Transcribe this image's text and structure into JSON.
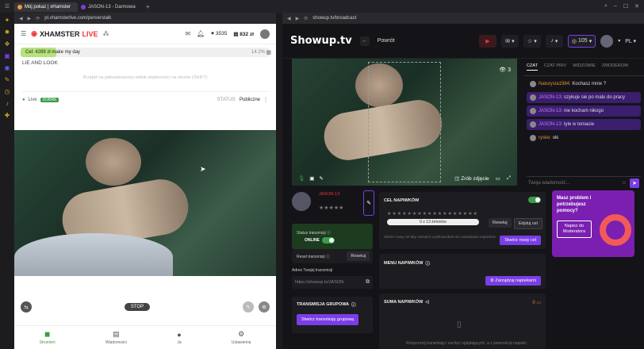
{
  "browser": {
    "tabs": [
      {
        "label": "Mój pokaz | xHamster"
      },
      {
        "label": "JASON-13 - Darmowa"
      }
    ],
    "left_url": "pl.xhamsterlive.com/perverstalk",
    "right_url": "showup.tv/broadcast"
  },
  "xh": {
    "logo_a": "XHAMSTER",
    "logo_b": "LIVE",
    "hearts": "3535",
    "tokens": "832 zł",
    "goal_text": "Cel: 4289 zł make my day",
    "goal_pct": "14.2%",
    "goal_fraction": 0.142,
    "subject": "LIE AND LOOK",
    "notice": "Przejdź na pełnoekranowy widok wiadomości na stronie (SHIFT)",
    "live_label": "Live",
    "quality": "DOBRE",
    "status_label": "STATUS:",
    "status_value": "Publiczne",
    "stop_label": "STOP",
    "nav": [
      {
        "label": "Strumień",
        "icon": "camera-icon"
      },
      {
        "label": "Wiadomości",
        "icon": "messages-icon"
      },
      {
        "label": "Ja",
        "icon": "user-icon"
      },
      {
        "label": "Ustawienia",
        "icon": "settings-icon"
      }
    ]
  },
  "sh": {
    "logo": "Showup.tv",
    "back_label": "Powrót",
    "tokens": "105",
    "lang": "PL",
    "viewers": "3",
    "snapshot_label": "Zrób zdjęcie",
    "chat_tabs": [
      "CZAT",
      "CZAT PRIV",
      "WIDZOWIE",
      "ZMODEROW"
    ],
    "messages": [
      {
        "user": "Naturysta1984:",
        "text": "Kochasz mnie ?",
        "hl": false,
        "orange": true
      },
      {
        "user": "JASON-13:",
        "text": "szykuje sie po malu do pracy",
        "hl": true,
        "orange": false
      },
      {
        "user": "JASON-13:",
        "text": "nie kocham nikogo",
        "hl": true,
        "orange": false
      },
      {
        "user": "JASON-13:",
        "text": "tyle w temacie",
        "hl": true,
        "orange": false
      },
      {
        "user": "ryske:",
        "text": "oki",
        "hl": false,
        "orange": true
      }
    ],
    "chat_placeholder": "Twoja wiadomość...",
    "username": "JASON-13",
    "stream_status_label": "Status transmisji",
    "online_label": "ONLINE",
    "reset_label": "Reset transmisji",
    "reset_btn": "Resetuj",
    "address_label": "Adres Twojej transmisji",
    "address_value": "https://showup.tv/JASON-",
    "group_label": "TRANSMISJA GRUPOWA",
    "group_btn": "Stwórz transmisję grupową",
    "tip_goal_title": "CEL NAPIWKÓW",
    "tip_goal_progress": "0 z 13 żetonów",
    "tip_reset": "Resetuj",
    "tip_edit": "Edytuj cel",
    "tip_goal_desc": "Stwórz nowy cel aby zachęcić użytkowników do zostawiania napiwków",
    "tip_new_goal": "Stwórz nowy cel",
    "tip_menu_title": "MENU NAPIWKÓW",
    "tip_manage": "Zarządzaj napiwkami",
    "tip_sum_title": "SUMA NAPIWKÓW",
    "tip_sum_value": "0",
    "tip_sum_desc": "Rozpocznij transmisję i zachęć oglądających, a z pewnością napiwki",
    "help_title": "Masz problem i potrzebujesz pomocy?",
    "help_btn": "Napisz do Moderatora"
  }
}
